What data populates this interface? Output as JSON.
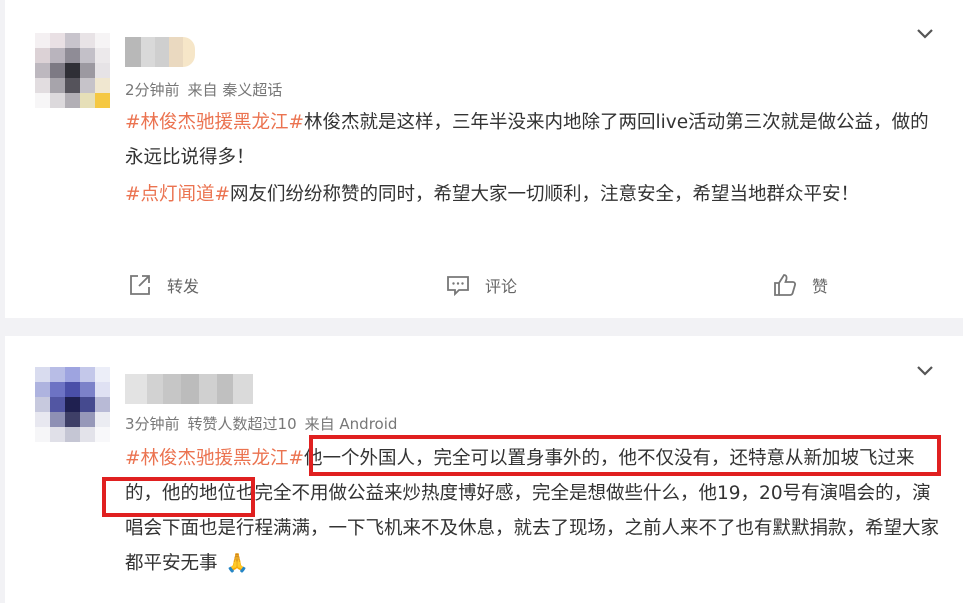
{
  "posts": [
    {
      "meta": {
        "time": "2分钟前",
        "source": "来自 秦义超话"
      },
      "content": {
        "topic1": "#林俊杰驰援黑龙江#",
        "text1": "林俊杰就是这样，三年半没来内地除了两回live活动第三次就是做公益，做的永远比说得多！",
        "topic2": "#点灯闻道#",
        "text2": "网友们纷纷称赞的同时，希望大家一切顺利，注意安全，希望当地群众平安！"
      },
      "actions": {
        "repost": "转发",
        "comment": "评论",
        "like": "赞"
      }
    },
    {
      "meta": {
        "time": "3分钟前",
        "reposts": "转赞人数超过10",
        "source": "来自 Android"
      },
      "content": {
        "topic1": "#林俊杰驰援黑龙江#",
        "highlight": "他一个外国人，完全可以置身事外的，他不仅没有，还特意从新加坡飞过来的，",
        "text1": "他的地位也完全不用做公益来炒热度博好感，完全是想做些什么，他19，20号有演唱会的，演唱会下面也是行程满满，一下飞机来不及休息，就去了现场，之前人来不了也有默默捐款，希望大家都平安无事",
        "emoji": "🙏"
      }
    }
  ],
  "icons": [
    "repost-icon",
    "comment-icon",
    "like-icon",
    "chevron-down-icon",
    "pray-emoji"
  ],
  "colors": {
    "topic": "#eb7350",
    "highlight_box": "#e02020",
    "background": "#f2f2f5"
  }
}
